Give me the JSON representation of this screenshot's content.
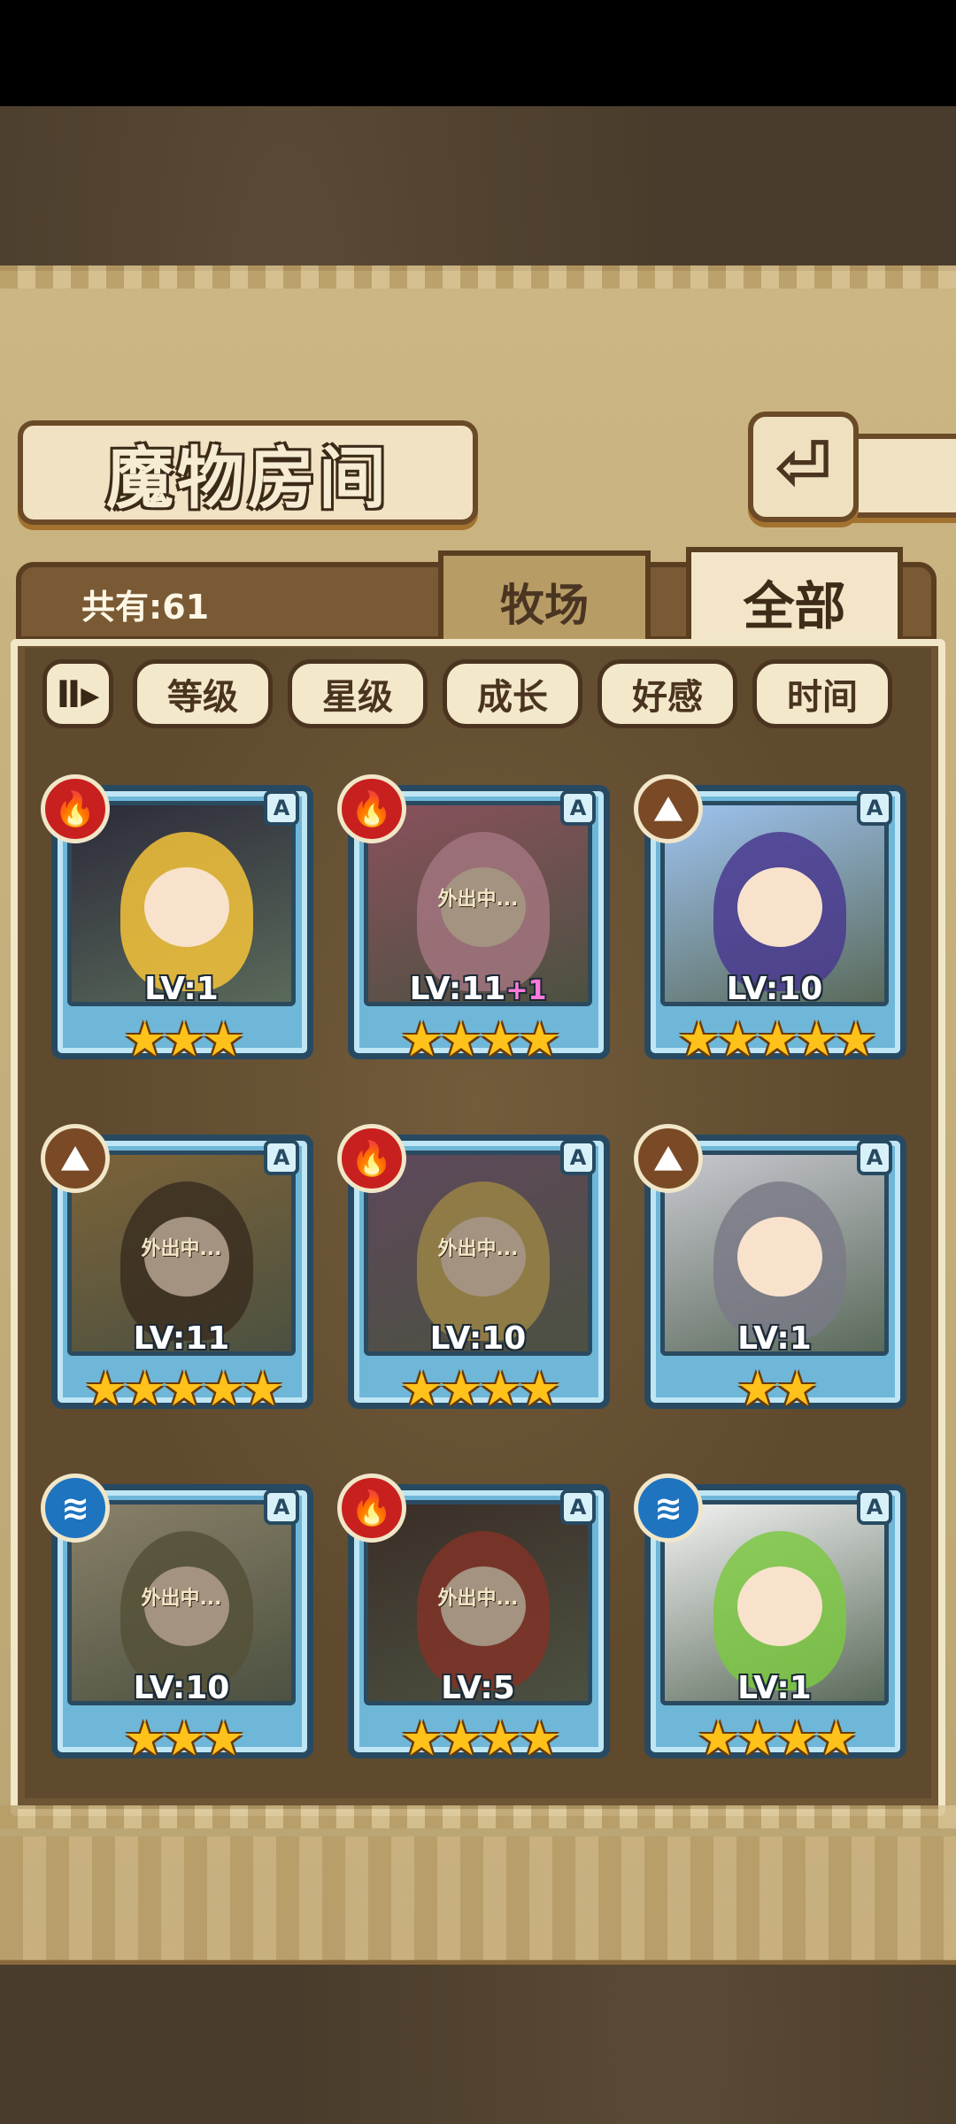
{
  "header": {
    "title": "魔物房间",
    "back_icon": "⏎",
    "count_text": "共有:61"
  },
  "tabs": [
    {
      "label": "牧场",
      "active": false
    },
    {
      "label": "全部",
      "active": true
    }
  ],
  "sort": {
    "toggle_label": "Ⅱ▸",
    "buttons": [
      "等级",
      "星级",
      "成长",
      "好感",
      "时间"
    ]
  },
  "cards": [
    {
      "element": "fire",
      "element_icon": "🔥",
      "rank": "A",
      "level": "LV:1",
      "level_bonus": "",
      "stars": "★★★",
      "away": "",
      "colors": [
        "#f5c33a",
        "#2c2a3a"
      ]
    },
    {
      "element": "fire",
      "element_icon": "🔥",
      "rank": "A",
      "level": "LV:11",
      "level_bonus": "+1",
      "stars": "★★★★",
      "away": "外出中...",
      "colors": [
        "#f6a9c9",
        "#c96a8a"
      ]
    },
    {
      "element": "earth",
      "element_icon": "⛰",
      "rank": "A",
      "level": "LV:10",
      "level_bonus": "",
      "stars": "★★★★★",
      "away": "",
      "colors": [
        "#4a3a8f",
        "#9ec3f0"
      ]
    },
    {
      "element": "earth",
      "element_icon": "⛰",
      "rank": "A",
      "level": "LV:11",
      "level_bonus": "",
      "stars": "★★★★★",
      "away": "外出中...",
      "colors": [
        "#3a2a1e",
        "#b08a4a"
      ]
    },
    {
      "element": "fire",
      "element_icon": "🔥",
      "rank": "A",
      "level": "LV:10",
      "level_bonus": "",
      "stars": "★★★★",
      "away": "外出中...",
      "colors": [
        "#e6c660",
        "#7a5a8a"
      ]
    },
    {
      "element": "earth",
      "element_icon": "⛰",
      "rank": "A",
      "level": "LV:1",
      "level_bonus": "",
      "stars": "★★",
      "away": "",
      "colors": [
        "#7a7a86",
        "#c8c8d0"
      ]
    },
    {
      "element": "water",
      "element_icon": "≋",
      "rank": "A",
      "level": "LV:10",
      "level_bonus": "",
      "stars": "★★★",
      "away": "外出中...",
      "colors": [
        "#6a6a4a",
        "#c9c0a0"
      ]
    },
    {
      "element": "fire",
      "element_icon": "🔥",
      "rank": "A",
      "level": "LV:5",
      "level_bonus": "",
      "stars": "★★★★",
      "away": "外出中...",
      "colors": [
        "#b8322a",
        "#3a2a2a"
      ]
    },
    {
      "element": "water",
      "element_icon": "≋",
      "rank": "A",
      "level": "LV:1",
      "level_bonus": "",
      "stars": "★★★★",
      "away": "",
      "colors": [
        "#7cc843",
        "#f2f2f2"
      ]
    }
  ],
  "element_colors": {
    "fire": "#c8201e",
    "earth": "#7a4a26",
    "water": "#1f74c0"
  }
}
